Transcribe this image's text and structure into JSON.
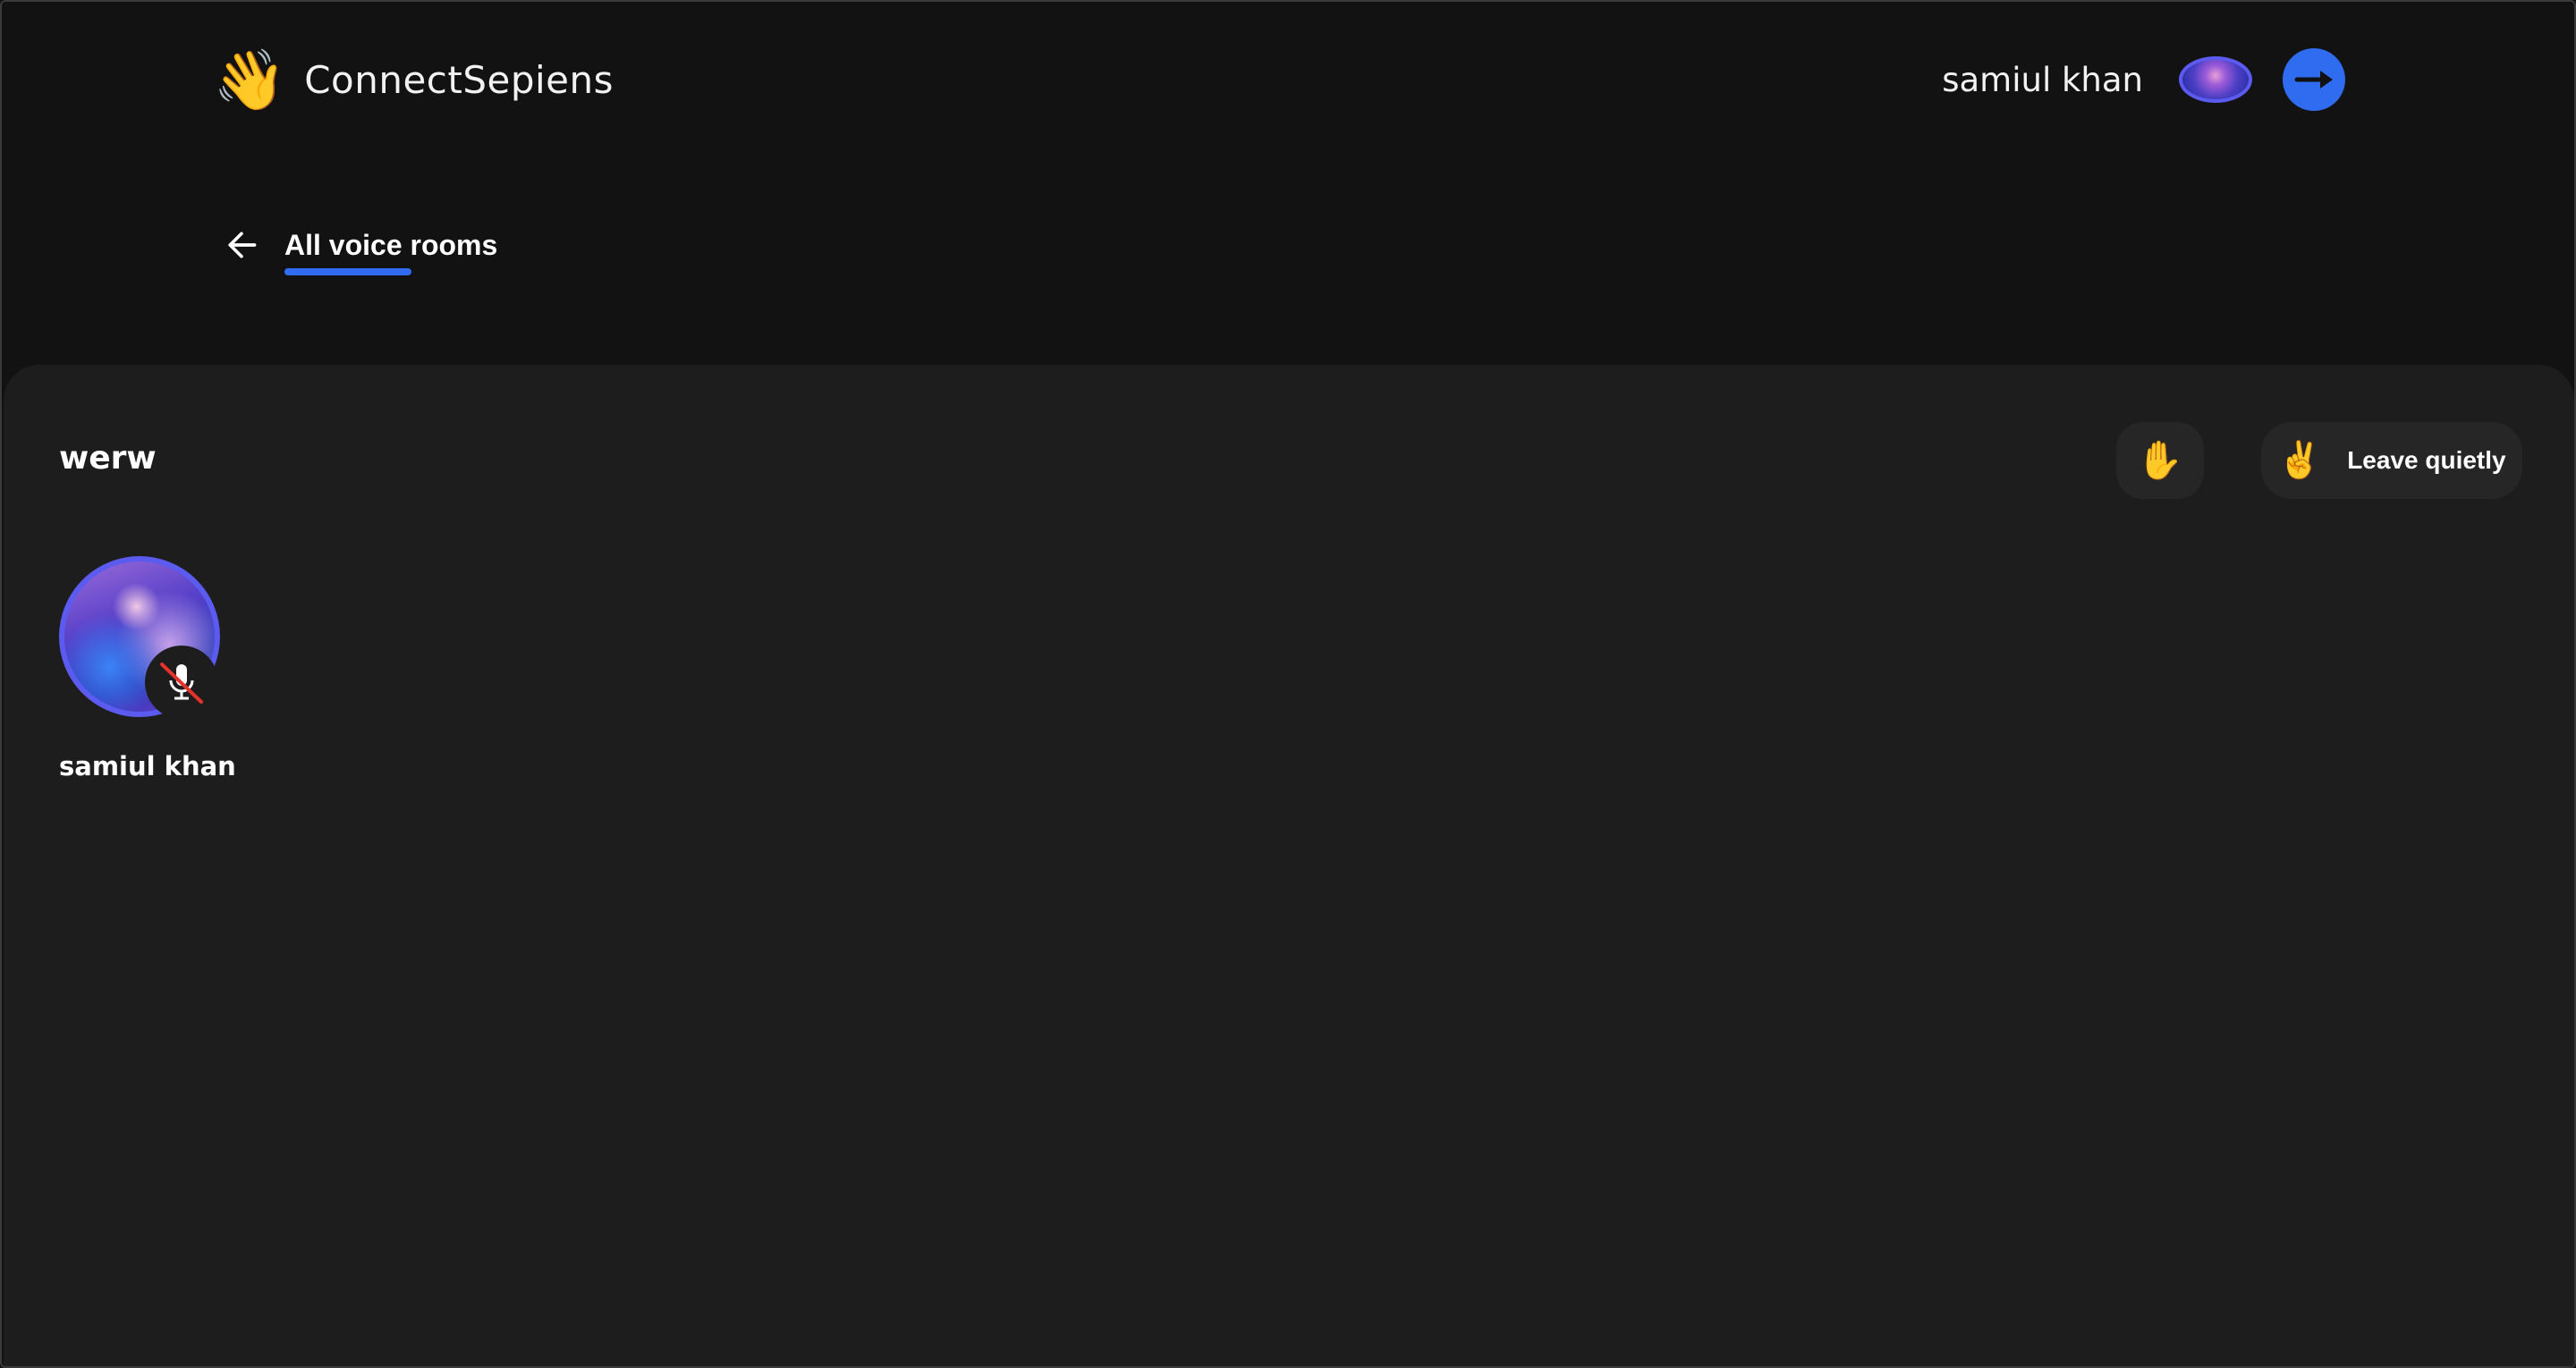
{
  "header": {
    "brand_icon": "waving-hand-emoji",
    "brand_emoji": "👋",
    "brand_name": "ConnectSepiens",
    "user_name": "samiul khan",
    "logout_icon": "arrow-right-icon"
  },
  "subnav": {
    "back_icon": "arrow-left-icon",
    "title": "All voice rooms"
  },
  "room": {
    "title": "werw",
    "raise_hand_emoji": "✋",
    "leave_emoji": "✌️",
    "leave_label": "Leave quietly",
    "speakers": [
      {
        "name": "samiul khan",
        "muted": true
      }
    ]
  },
  "colors": {
    "accent": "#2f6cf0",
    "avatar_ring": "#5b5bf0",
    "background": "#121212",
    "panel": "#1d1d1d",
    "button": "#262626"
  }
}
